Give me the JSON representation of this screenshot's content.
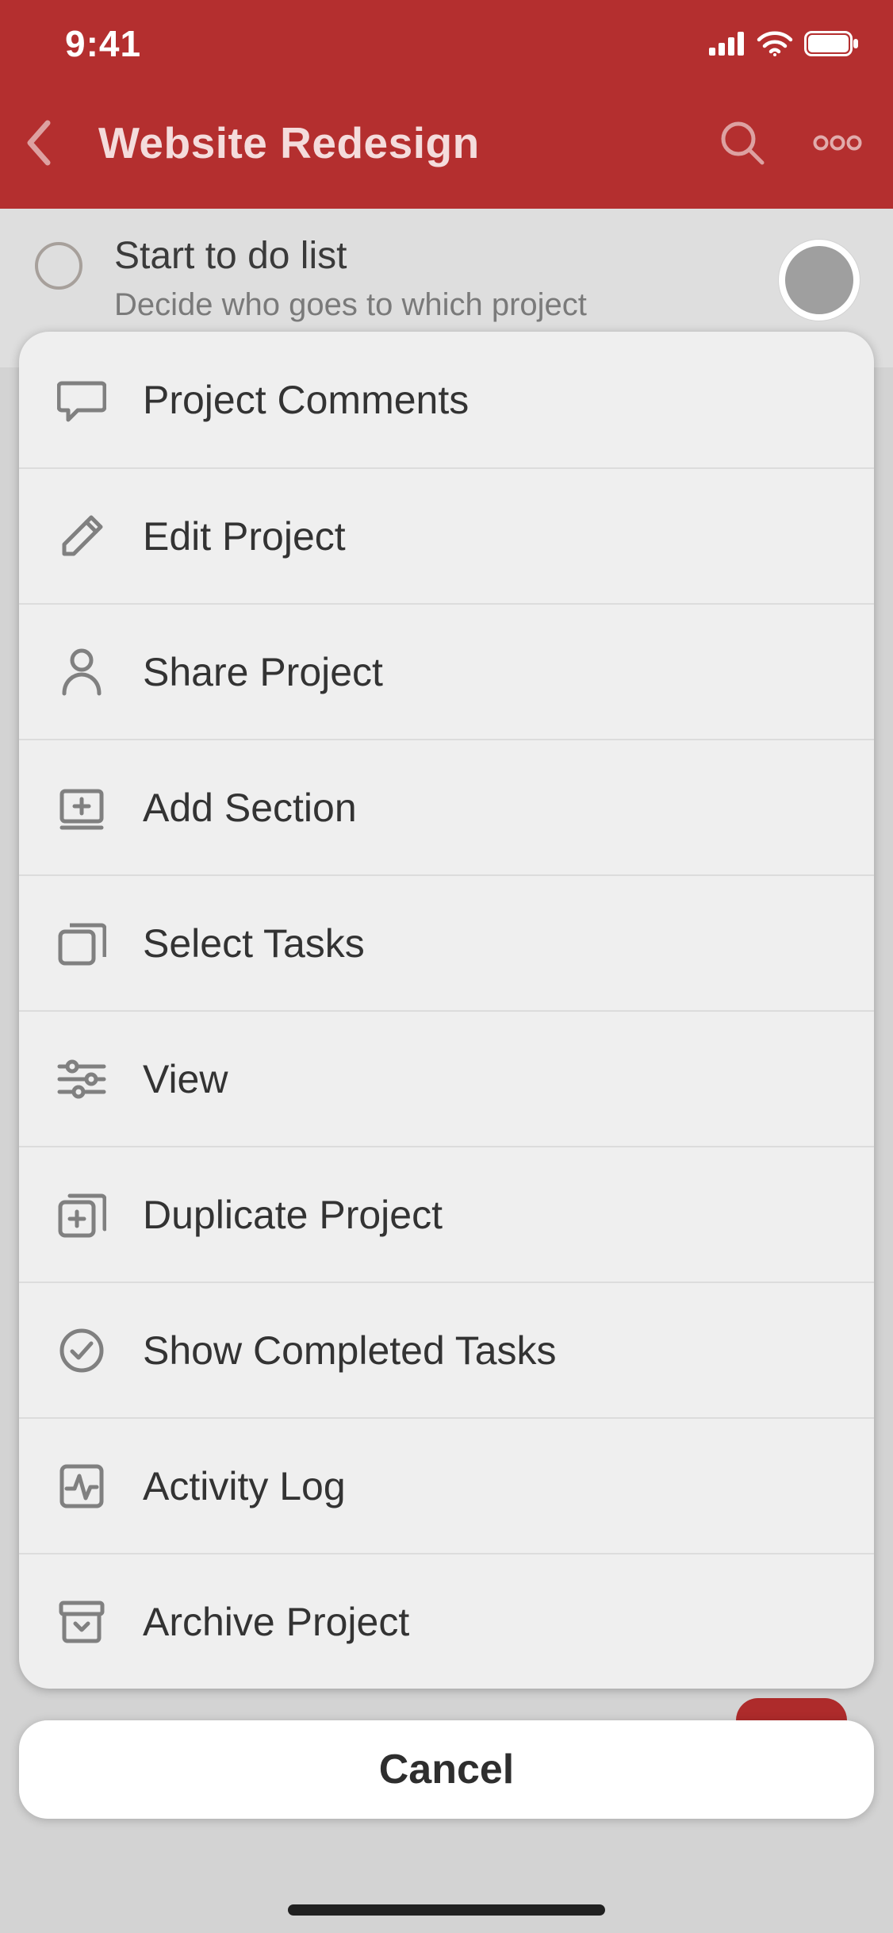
{
  "statusbar": {
    "time": "9:41"
  },
  "navbar": {
    "title": "Website Redesign"
  },
  "task": {
    "title": "Start to do list",
    "subtitle": "Decide who goes to which project"
  },
  "sheet": {
    "items": {
      "comments": {
        "label": "Project Comments"
      },
      "edit": {
        "label": "Edit Project"
      },
      "share": {
        "label": "Share Project"
      },
      "section": {
        "label": "Add Section"
      },
      "select": {
        "label": "Select Tasks"
      },
      "view": {
        "label": "View"
      },
      "duplicate": {
        "label": "Duplicate Project"
      },
      "completed": {
        "label": "Show Completed Tasks"
      },
      "activity": {
        "label": "Activity Log"
      },
      "archive": {
        "label": "Archive Project"
      }
    },
    "cancel": "Cancel"
  }
}
